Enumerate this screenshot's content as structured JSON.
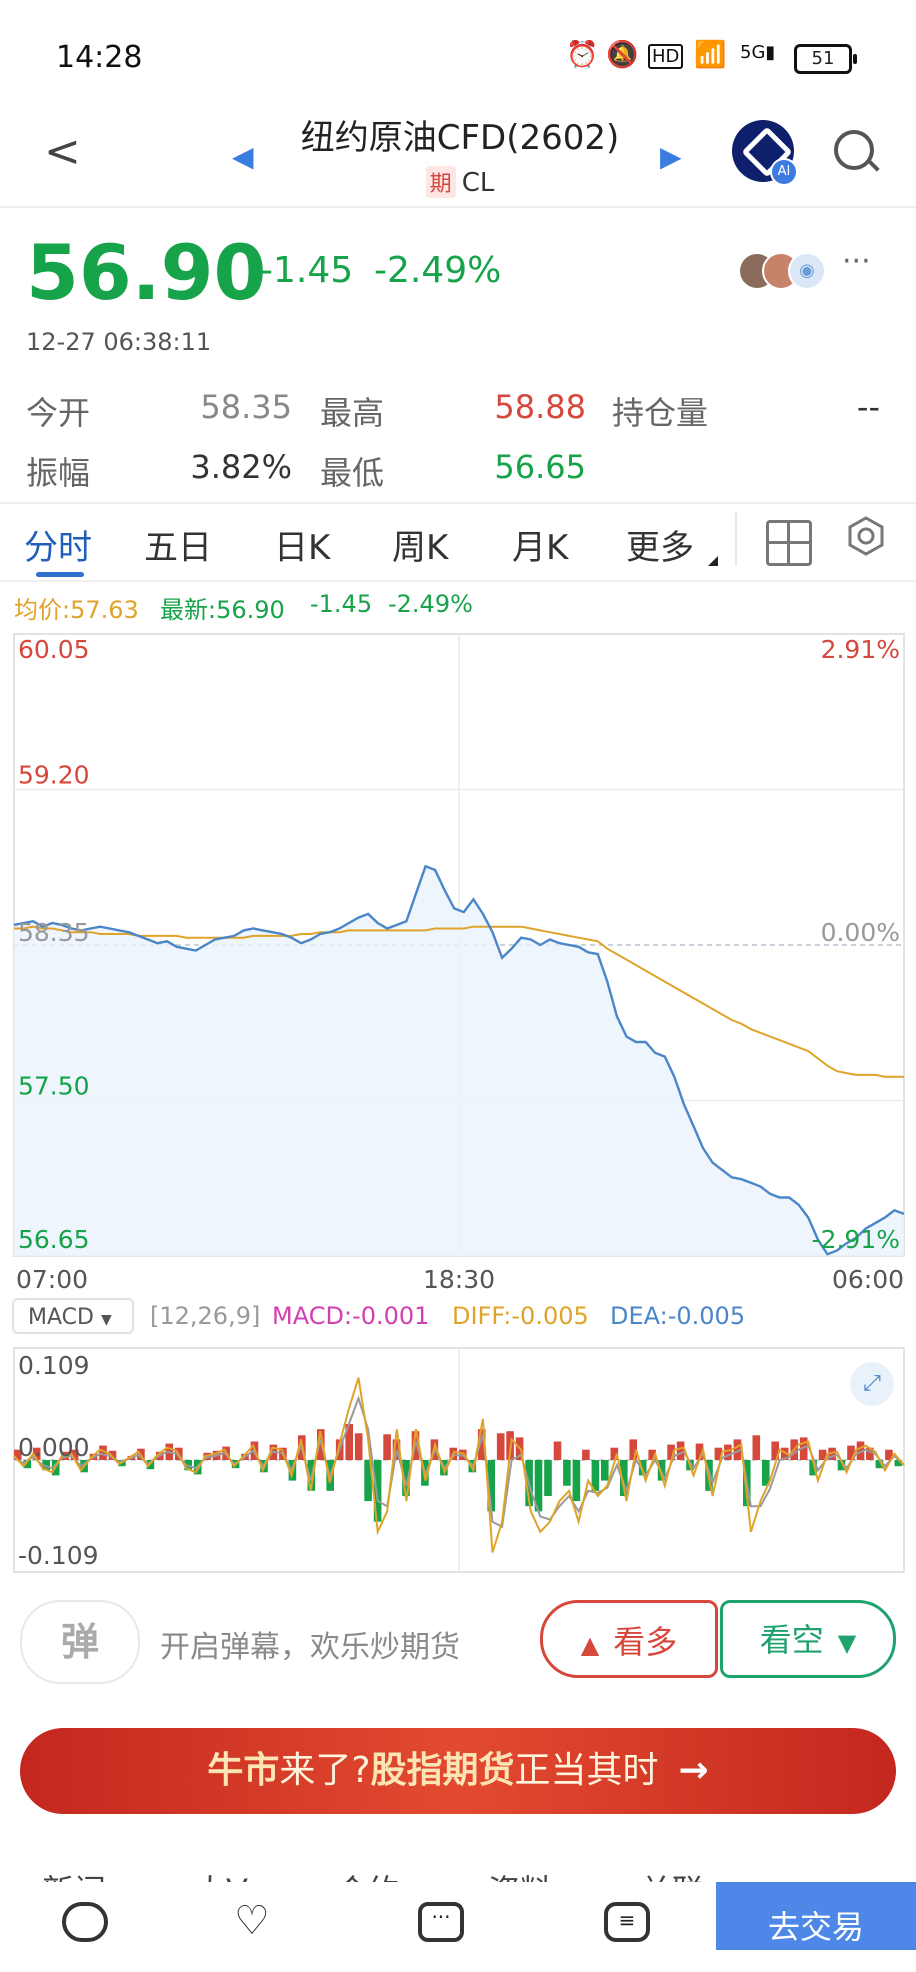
{
  "status_bar": {
    "time": "14:28",
    "battery": "51"
  },
  "header": {
    "title": "纽约原油CFD(2602)",
    "badge": "期",
    "code": "CL",
    "ai_label": "AI"
  },
  "quote": {
    "price": "56.90",
    "change": "-1.45",
    "change_pct": "-2.49%",
    "datetime": "12-27 06:38:11",
    "more": "···",
    "stats": {
      "open_label": "今开",
      "open_value": "58.35",
      "high_label": "最高",
      "high_value": "58.88",
      "oi_label": "持仓量",
      "oi_value": "--",
      "amp_label": "振幅",
      "amp_value": "3.82%",
      "low_label": "最低",
      "low_value": "56.65"
    }
  },
  "tabs": [
    "分时",
    "五日",
    "日K",
    "周K",
    "月K",
    "更多"
  ],
  "info_line": {
    "avg": "均价:57.63",
    "latest": "最新:56.90",
    "change": "-1.45",
    "change_pct": "-2.49%"
  },
  "chart_data": {
    "type": "line",
    "y_labels_left": [
      "60.05",
      "59.20",
      "58.35",
      "57.50",
      "56.65"
    ],
    "y_labels_right": [
      "2.91%",
      "0.00%",
      "-2.91%"
    ],
    "right_bottom_label": "2.91%",
    "x_labels": [
      "07:00",
      "18:30",
      "06:00"
    ],
    "ylim": [
      56.65,
      60.05
    ],
    "prev_close": 58.35,
    "series": [
      {
        "color": "#4a86c8",
        "values": [
          58.46,
          58.47,
          58.48,
          58.45,
          58.47,
          58.46,
          58.44,
          58.43,
          58.44,
          58.45,
          58.44,
          58.43,
          58.42,
          58.4,
          58.38,
          58.36,
          58.37,
          58.34,
          58.33,
          58.32,
          58.35,
          58.38,
          58.39,
          58.4,
          58.43,
          58.44,
          58.43,
          58.42,
          58.41,
          58.39,
          58.36,
          58.38,
          58.41,
          58.42,
          58.44,
          58.47,
          58.5,
          58.52,
          58.47,
          58.44,
          58.46,
          58.48,
          58.63,
          58.78,
          58.76,
          58.65,
          58.55,
          58.53,
          58.6,
          58.52,
          58.42,
          58.28,
          58.33,
          58.39,
          58.38,
          58.35,
          58.38,
          58.36,
          58.35,
          58.34,
          58.31,
          58.3,
          58.15,
          57.96,
          57.85,
          57.82,
          57.82,
          57.76,
          57.74,
          57.63,
          57.48,
          57.36,
          57.24,
          57.16,
          57.12,
          57.08,
          57.07,
          57.05,
          57.03,
          56.99,
          56.97,
          56.97,
          56.93,
          56.86,
          56.74,
          56.66,
          56.68,
          56.72,
          56.75,
          56.8,
          56.83,
          56.86,
          56.9,
          56.88
        ]
      },
      {
        "color": "#e0a32a",
        "values": [
          58.44,
          58.44,
          58.45,
          58.44,
          58.44,
          58.43,
          58.42,
          58.42,
          58.42,
          58.41,
          58.41,
          58.41,
          58.41,
          58.4,
          58.4,
          58.4,
          58.4,
          58.4,
          58.39,
          58.39,
          58.39,
          58.39,
          58.39,
          58.39,
          58.39,
          58.4,
          58.4,
          58.4,
          58.4,
          58.4,
          58.41,
          58.41,
          58.42,
          58.42,
          58.42,
          58.43,
          58.43,
          58.43,
          58.43,
          58.43,
          58.43,
          58.43,
          58.43,
          58.43,
          58.44,
          58.44,
          58.44,
          58.44,
          58.45,
          58.45,
          58.45,
          58.45,
          58.45,
          58.45,
          58.44,
          58.43,
          58.42,
          58.41,
          58.4,
          58.39,
          58.38,
          58.37,
          58.33,
          58.3,
          58.27,
          58.24,
          58.21,
          58.18,
          58.15,
          58.12,
          58.09,
          58.06,
          58.03,
          58.0,
          57.97,
          57.94,
          57.92,
          57.89,
          57.87,
          57.85,
          57.83,
          57.81,
          57.79,
          57.77,
          57.73,
          57.69,
          57.66,
          57.65,
          57.64,
          57.64,
          57.64,
          57.63,
          57.63,
          57.63
        ]
      }
    ]
  },
  "macd": {
    "selector": "MACD",
    "params": "[12,26,9]",
    "macd": "MACD:-0.001",
    "diff": "DIFF:-0.005",
    "dea": "DEA:-0.005",
    "y_labels": [
      "0.109",
      "0.000",
      "-0.109"
    ],
    "ylim": [
      -0.109,
      0.109
    ],
    "histogram": [
      0.01,
      -0.008,
      0.012,
      -0.01,
      -0.015,
      0.008,
      0.01,
      -0.012,
      0.006,
      0.014,
      0.009,
      -0.006,
      0.004,
      0.011,
      -0.009,
      0.008,
      0.016,
      0.012,
      -0.01,
      -0.014,
      0.007,
      0.009,
      0.013,
      -0.008,
      0.006,
      0.018,
      -0.012,
      0.015,
      0.012,
      -0.02,
      0.024,
      -0.03,
      0.03,
      -0.03,
      0.02,
      0.035,
      0.026,
      -0.04,
      -0.06,
      0.025,
      0.02,
      -0.035,
      0.028,
      -0.025,
      0.02,
      -0.015,
      0.012,
      0.01,
      -0.012,
      0.03,
      -0.05,
      0.026,
      0.028,
      0.022,
      -0.045,
      -0.05,
      -0.035,
      0.018,
      -0.025,
      -0.04,
      0.01,
      -0.03,
      -0.02,
      0.012,
      -0.035,
      0.02,
      -0.015,
      0.01,
      -0.02,
      0.015,
      0.018,
      -0.01,
      0.016,
      -0.03,
      0.012,
      0.015,
      0.02,
      -0.045,
      0.024,
      -0.025,
      0.018,
      0.012,
      0.02,
      0.022,
      -0.015,
      0.01,
      0.012,
      -0.01,
      0.014,
      0.018,
      0.012,
      -0.008,
      0.01,
      -0.006
    ],
    "diff_line": [
      0.004,
      -0.006,
      0.006,
      -0.008,
      -0.012,
      0.004,
      0.006,
      -0.01,
      0.002,
      0.01,
      0.006,
      -0.004,
      0.002,
      0.008,
      -0.006,
      0.005,
      0.012,
      0.009,
      -0.008,
      -0.012,
      0.004,
      0.006,
      0.01,
      -0.006,
      0.004,
      0.014,
      -0.01,
      0.012,
      0.01,
      -0.015,
      0.02,
      -0.03,
      0.028,
      -0.022,
      0.015,
      0.05,
      0.08,
      0.02,
      -0.07,
      -0.05,
      0.03,
      -0.04,
      0.03,
      -0.02,
      0.015,
      -0.012,
      0.008,
      0.006,
      -0.01,
      0.04,
      -0.09,
      -0.06,
      0.02,
      0.01,
      -0.05,
      -0.07,
      -0.06,
      -0.04,
      -0.03,
      -0.06,
      -0.02,
      -0.035,
      -0.025,
      0.006,
      -0.04,
      0.01,
      -0.02,
      0.006,
      -0.025,
      0.01,
      0.012,
      -0.015,
      0.01,
      -0.035,
      0.008,
      0.01,
      0.015,
      -0.07,
      -0.04,
      -0.02,
      0.01,
      0.005,
      0.015,
      0.018,
      -0.02,
      0.006,
      0.008,
      -0.012,
      0.01,
      0.014,
      0.008,
      -0.01,
      0.006,
      -0.005
    ],
    "dea_line": [
      0.002,
      -0.003,
      0.003,
      -0.005,
      -0.008,
      0.002,
      0.004,
      -0.006,
      0.001,
      0.006,
      0.004,
      -0.002,
      0.001,
      0.005,
      -0.004,
      0.003,
      0.008,
      0.006,
      -0.005,
      -0.008,
      0.002,
      0.004,
      0.007,
      -0.004,
      0.002,
      0.009,
      -0.006,
      0.008,
      0.007,
      -0.01,
      0.014,
      -0.02,
      0.02,
      -0.016,
      0.01,
      0.035,
      0.06,
      0.03,
      -0.04,
      -0.045,
      0.01,
      -0.025,
      0.018,
      -0.014,
      0.01,
      -0.008,
      0.005,
      0.004,
      -0.006,
      0.025,
      -0.06,
      -0.065,
      0.0,
      0.005,
      -0.03,
      -0.055,
      -0.058,
      -0.045,
      -0.035,
      -0.05,
      -0.03,
      -0.032,
      -0.027,
      -0.005,
      -0.03,
      0.0,
      -0.015,
      0.0,
      -0.018,
      0.004,
      0.008,
      -0.008,
      0.006,
      -0.022,
      0.002,
      0.006,
      0.01,
      -0.045,
      -0.045,
      -0.028,
      0.0,
      0.003,
      0.01,
      0.014,
      -0.01,
      0.002,
      0.005,
      -0.008,
      0.006,
      0.01,
      0.006,
      -0.006,
      0.004,
      -0.005
    ]
  },
  "actions": {
    "danmu_icon": "弹",
    "danmu_tip": "开启弹幕，欢乐炒期货",
    "bull": "看多",
    "bear": "看空"
  },
  "banner": {
    "part1": "牛市",
    "part2": "来了?",
    "part3": "股指期货",
    "part4": "正当其时",
    "arrow": "→"
  },
  "bottom_tabs": [
    "新闻",
    "大V",
    "合约",
    "资料",
    "关联"
  ],
  "bottom_button": "去交易",
  "colors": {
    "up": "#d6473c",
    "down": "#17a34a",
    "price_line": "#4a86c8",
    "avg_line": "#e0a32a",
    "tab_active": "#1f5fb8"
  }
}
